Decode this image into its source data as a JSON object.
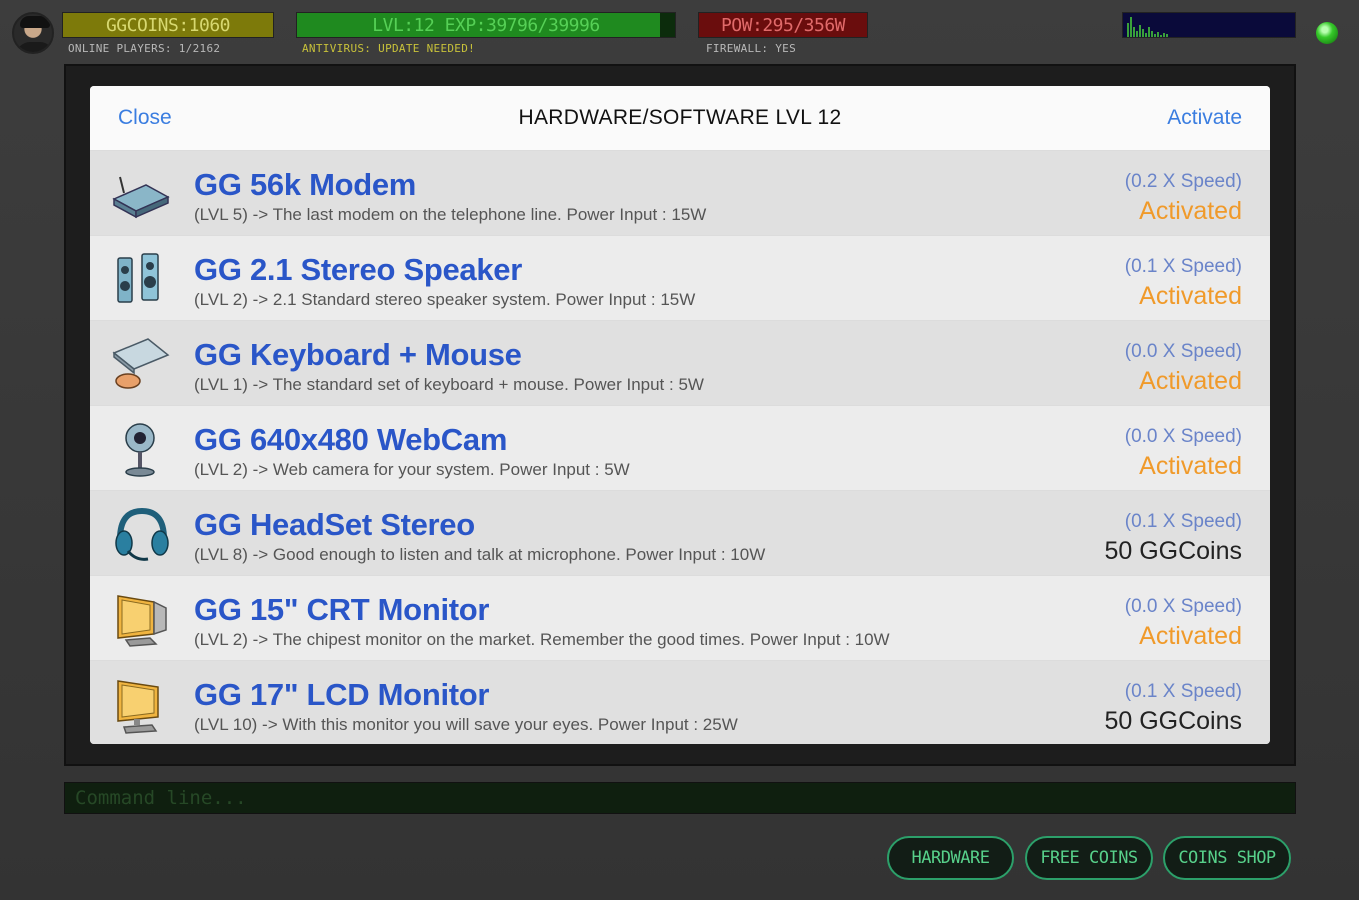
{
  "hud": {
    "coins": "GGCOINS:1060",
    "online_players": "ONLINE PLAYERS: 1/2162",
    "level_exp": "LVL:12  EXP:39796/39996",
    "exp_progress": 0.96,
    "antivirus": "ANTIVIRUS: UPDATE NEEDED!",
    "power": "POW:295/356W",
    "firewall": "FIREWALL: YES",
    "status_led_color": "#36c92a"
  },
  "dialog": {
    "close_label": "Close",
    "title": "HARDWARE/SOFTWARE LVL 12",
    "activate_label": "Activate",
    "items": [
      {
        "icon": "modem-icon",
        "name": "GG 56k Modem",
        "desc": "(LVL 5) -> The last modem on the telephone line. Power Input : 15W",
        "speed": "(0.2 X Speed)",
        "status": "Activated",
        "activated": true
      },
      {
        "icon": "speaker-icon",
        "name": "GG 2.1 Stereo Speaker",
        "desc": "(LVL 2) -> 2.1 Standard stereo speaker system. Power Input : 15W",
        "speed": "(0.1 X Speed)",
        "status": "Activated",
        "activated": true
      },
      {
        "icon": "keyboard-mouse-icon",
        "name": "GG Keyboard + Mouse",
        "desc": "(LVL 1) -> The standard set of keyboard + mouse. Power Input : 5W",
        "speed": "(0.0 X Speed)",
        "status": "Activated",
        "activated": true
      },
      {
        "icon": "webcam-icon",
        "name": "GG 640x480 WebCam",
        "desc": "(LVL 2) -> Web camera for your system. Power Input : 5W",
        "speed": "(0.0 X Speed)",
        "status": "Activated",
        "activated": true
      },
      {
        "icon": "headset-icon",
        "name": "GG HeadSet Stereo",
        "desc": "(LVL 8) -> Good enough to listen and talk at microphone. Power Input : 10W",
        "speed": "(0.1 X Speed)",
        "status": "50 GGCoins",
        "activated": false
      },
      {
        "icon": "crt-monitor-icon",
        "name": "GG 15\" CRT Monitor",
        "desc": "(LVL 2) -> The chipest monitor on the market. Remember the good times. Power Input : 10W",
        "speed": "(0.0 X Speed)",
        "status": "Activated",
        "activated": true
      },
      {
        "icon": "lcd-monitor-icon",
        "name": "GG 17\" LCD Monitor",
        "desc": "(LVL 10) -> With this monitor you will save your eyes. Power Input : 25W",
        "speed": "(0.1 X Speed)",
        "status": "50 GGCoins",
        "activated": false
      }
    ]
  },
  "command_line": {
    "placeholder": "Command line..."
  },
  "buttons": {
    "hardware": "HARDWARE",
    "free_coins": "FREE COINS",
    "coins_shop": "COINS SHOP"
  }
}
